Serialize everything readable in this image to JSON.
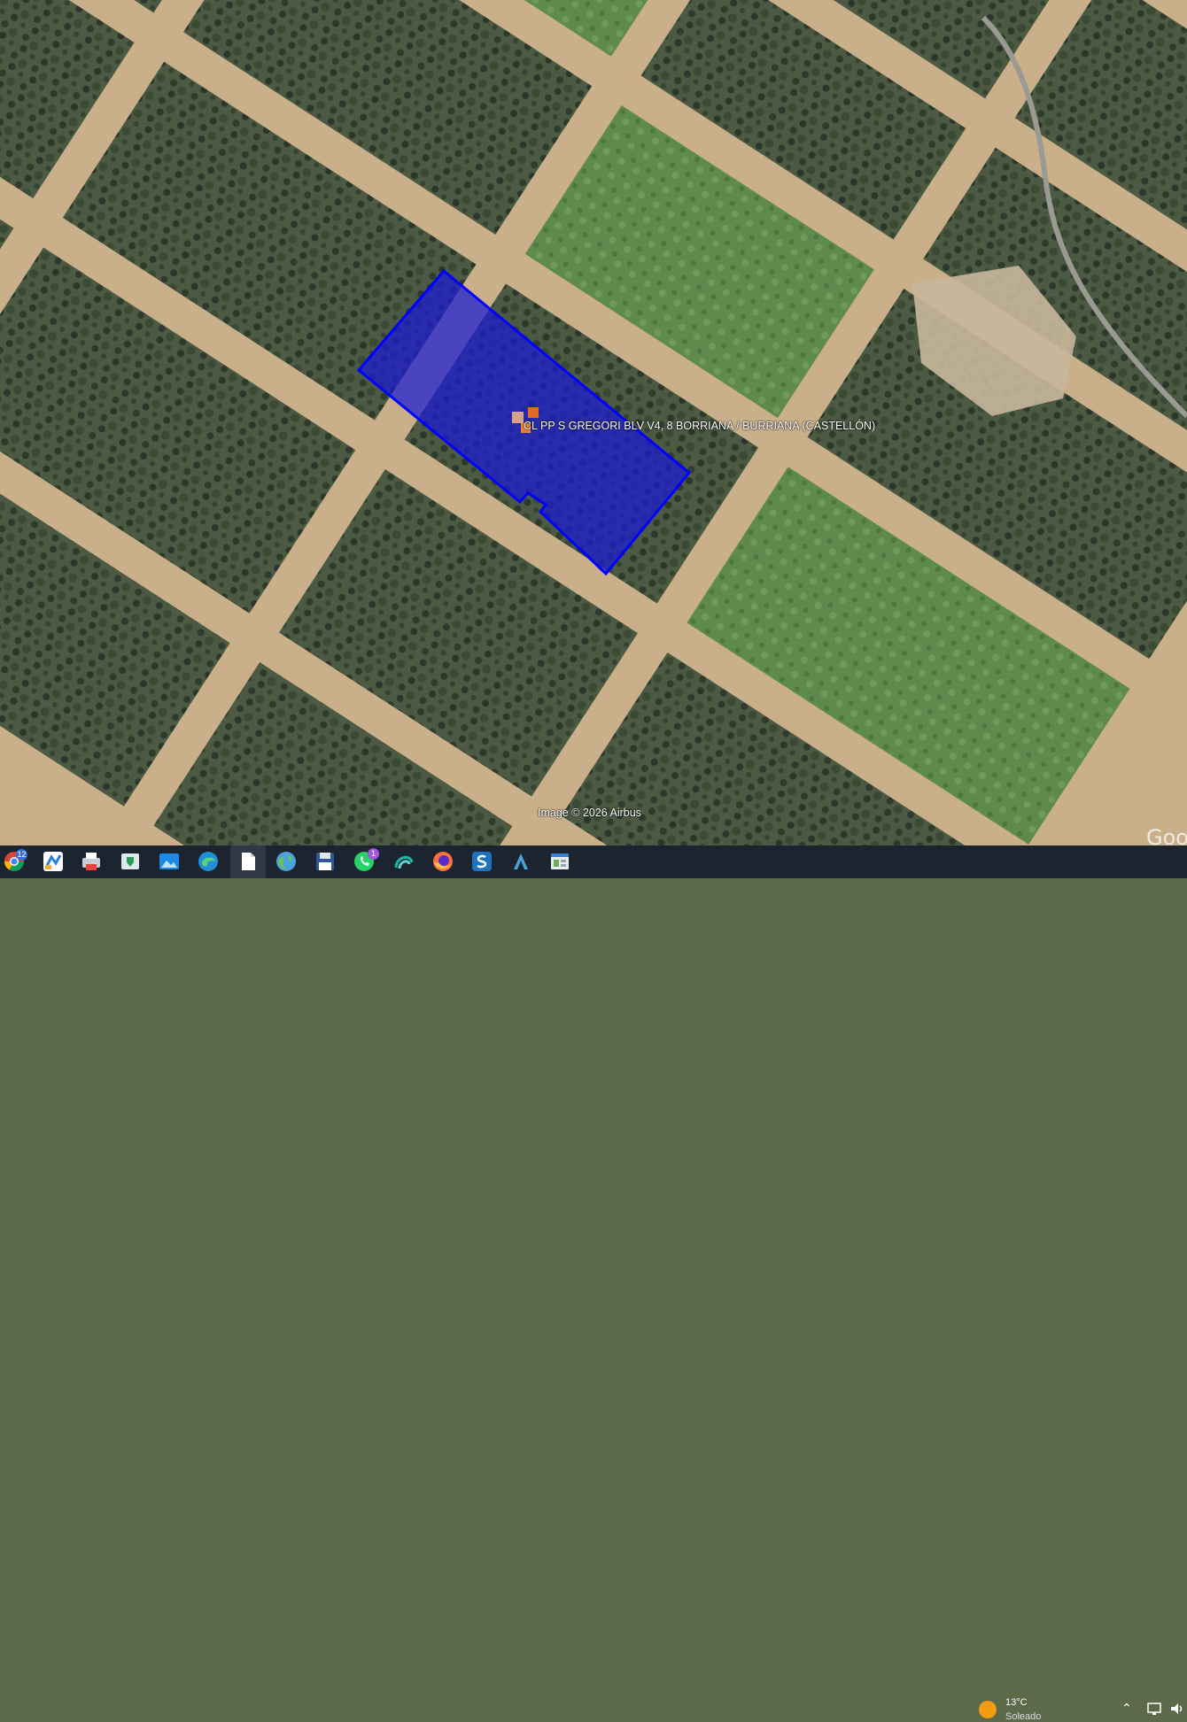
{
  "map": {
    "place_label": "CL PP S GREGORI BLV V4, 8  BORRIANA / BURRIANA (CASTELLÓN)",
    "attribution": "Image © 2026 Airbus",
    "logo_text": "Goo",
    "parcel_fill": "#1a1ad6",
    "parcel_stroke": "#0000ff",
    "marker_colors": [
      "#e06a2a",
      "#d9a08c",
      "#f08030"
    ]
  },
  "taskbar": {
    "icons": [
      "chrome-icon",
      "maps-app-icon",
      "printer-icon",
      "security-app-icon",
      "photos-icon",
      "edge-icon",
      "notepad-icon",
      "globe-icon",
      "save-disk-icon",
      "whatsapp-icon",
      "swirl-app-icon",
      "firefox-icon",
      "s-app-icon",
      "arrow-app-icon",
      "window-app-icon"
    ],
    "chrome_badge": "12",
    "whatsapp_badge": "1",
    "weather_temp": "13°C",
    "weather_condition": "Soleado",
    "tray_icons": [
      "chevron-up-icon",
      "network-icon",
      "volume-icon"
    ]
  }
}
